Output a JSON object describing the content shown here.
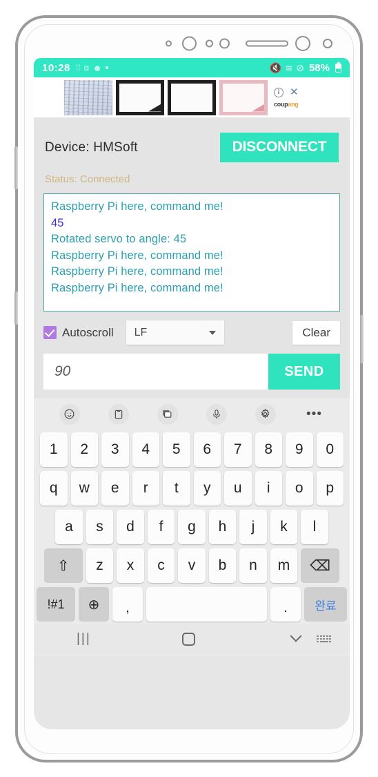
{
  "status_bar": {
    "clock": "10:28",
    "battery_percent": "58%",
    "icons_left": [
      "notification-dots-icon",
      "screenshot-icon",
      "messenger-icon",
      "dot-icon"
    ],
    "icons_right": [
      "mute-icon",
      "wifi-icon",
      "do-not-disturb-icon"
    ]
  },
  "ad": {
    "info_glyph": "i",
    "close_glyph": "✕",
    "brand_part1": "coup",
    "brand_part2": "ang",
    "thumbnails": [
      "circuit-board-thumbnail",
      "whiteboard-thumbnail",
      "whiteboard-plain-thumbnail",
      "pink-whiteboard-thumbnail"
    ]
  },
  "app": {
    "device_label": "Device: HMSoft",
    "disconnect_label": "DISCONNECT",
    "status_line": "Status: Connected",
    "accent_color": "#2fe3bf",
    "status_color": "#cdb682",
    "terminal": {
      "lines": [
        {
          "text": "Raspberry Pi here, command me!",
          "dir": "rx"
        },
        {
          "text": "45",
          "dir": "tx"
        },
        {
          "text": "Rotated servo to angle: 45",
          "dir": "rx"
        },
        {
          "text": "Raspberry Pi here, command me!",
          "dir": "rx"
        },
        {
          "text": "Raspberry Pi here, command me!",
          "dir": "rx"
        },
        {
          "text": "Raspberry Pi here, command me!",
          "dir": "rx"
        }
      ],
      "rx_color": "#2b9fb0",
      "tx_color": "#3a2fd8"
    },
    "controls": {
      "autoscroll_label": "Autoscroll",
      "autoscroll_checked": true,
      "line_ending_value": "LF",
      "clear_label": "Clear"
    },
    "send": {
      "input_value": "90",
      "input_placeholder": "90",
      "send_label": "SEND"
    }
  },
  "keyboard": {
    "toolbar_icons": [
      "emoji-icon",
      "clipboard-icon",
      "sticker-icon",
      "microphone-icon",
      "settings-gear-icon",
      "more-options-icon"
    ],
    "row_numbers": [
      "1",
      "2",
      "3",
      "4",
      "5",
      "6",
      "7",
      "8",
      "9",
      "0"
    ],
    "row_top": [
      "q",
      "w",
      "e",
      "r",
      "t",
      "y",
      "u",
      "i",
      "o",
      "p"
    ],
    "row_home": [
      "a",
      "s",
      "d",
      "f",
      "g",
      "h",
      "j",
      "k",
      "l"
    ],
    "row_bottom": [
      "z",
      "x",
      "c",
      "v",
      "b",
      "n",
      "m"
    ],
    "shift_label": "⇧",
    "backspace_label": "⌫",
    "symbols_label": "!#1",
    "globe_label": "⊕",
    "comma_label": ",",
    "space_label": "",
    "period_label": ".",
    "done_label": "완료"
  },
  "nav_bar": {
    "recents_label": "|||",
    "home_icon": "home-square-icon",
    "back_icon": "chevron-down-icon",
    "keyboard_toggle_icon": "keyboard-toggle-icon"
  }
}
